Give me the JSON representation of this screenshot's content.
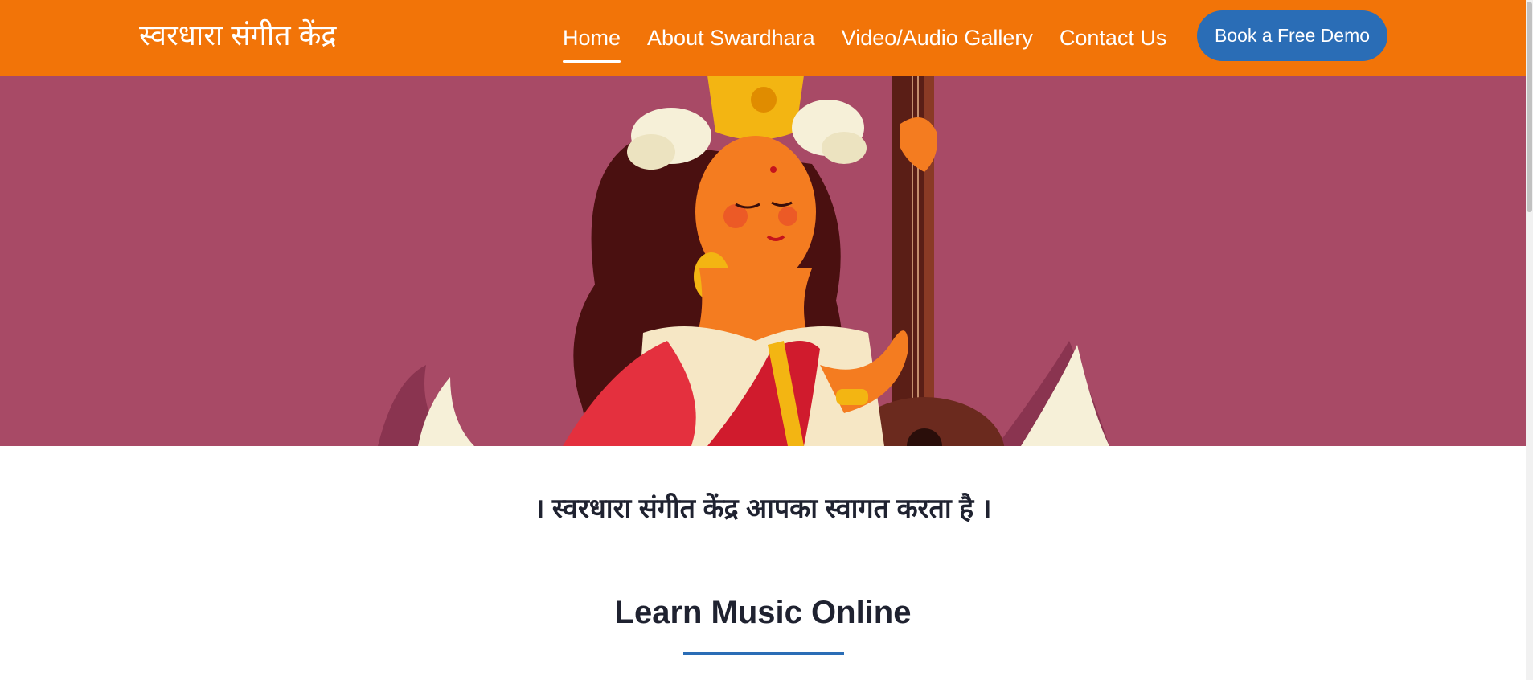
{
  "header": {
    "brand": "स्वरधारा संगीत केंद्र",
    "nav": [
      {
        "label": "Home",
        "active": true
      },
      {
        "label": "About Swardhara",
        "active": false
      },
      {
        "label": "Video/Audio Gallery",
        "active": false
      },
      {
        "label": "Contact Us",
        "active": false
      }
    ],
    "cta_label": "Book a Free Demo"
  },
  "hero": {
    "image": "saraswati-with-veena-illustration"
  },
  "main": {
    "welcome": "। स्वरधारा संगीत केंद्र आपका स्वागत करता है ।",
    "section_title": "Learn Music Online"
  },
  "colors": {
    "header_bg": "#f27408",
    "hero_bg": "#a84a66",
    "accent_blue": "#2a6db6",
    "heading_text": "#1f2230"
  }
}
